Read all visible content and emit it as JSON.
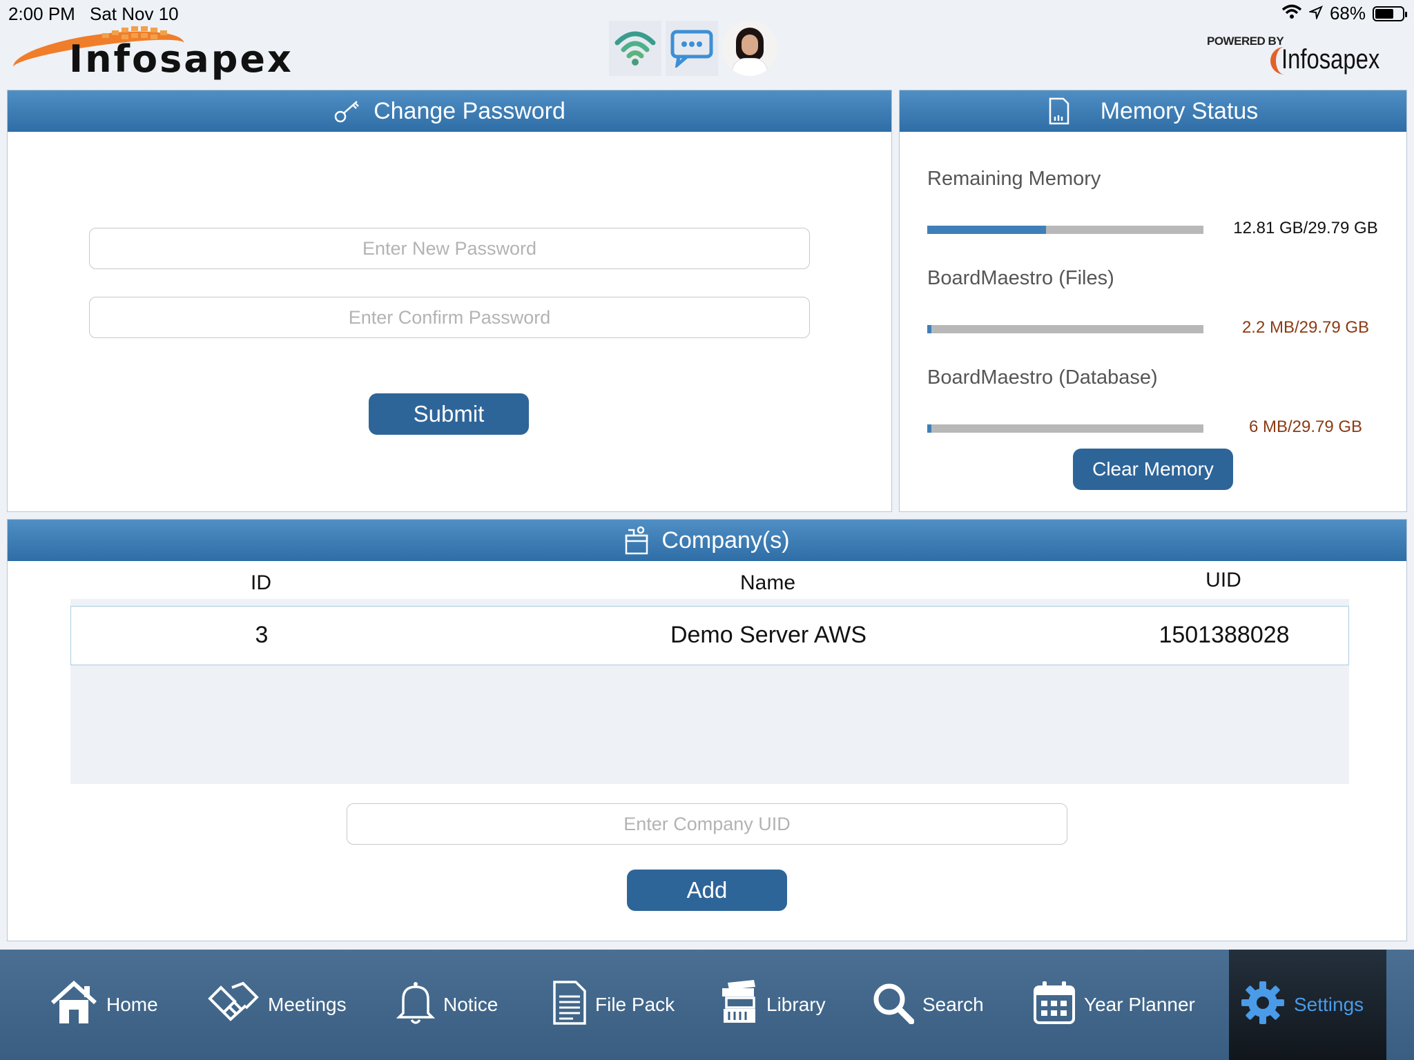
{
  "status_bar": {
    "time": "2:00 PM",
    "date": "Sat Nov 10",
    "battery": "68%",
    "battery_level": 0.68
  },
  "header": {
    "brand": "Infosapex",
    "powered_by": "POWERED BY",
    "powered_brand": "Infosapex"
  },
  "change_password": {
    "title": "Change Password",
    "new_password_placeholder": "Enter New Password",
    "confirm_password_placeholder": "Enter Confirm Password",
    "submit_label": "Submit"
  },
  "memory_status": {
    "title": "Memory Status",
    "items": [
      {
        "label": "Remaining Memory",
        "value": "12.81 GB/29.79 GB",
        "fraction": 0.43,
        "value_color": "#111111"
      },
      {
        "label": "BoardMaestro (Files)",
        "value": "2.2 MB/29.79 GB",
        "fraction": 0.015,
        "value_color": "#8b3a13"
      },
      {
        "label": "BoardMaestro (Database)",
        "value": "6 MB/29.79 GB",
        "fraction": 0.015,
        "value_color": "#8b3a13"
      }
    ],
    "clear_label": "Clear Memory"
  },
  "companies": {
    "title": "Company(s)",
    "columns": [
      "ID",
      "Name",
      "UID"
    ],
    "rows": [
      {
        "id": "3",
        "name": "Demo Server AWS",
        "uid": "1501388028"
      }
    ],
    "uid_placeholder": "Enter Company UID",
    "add_label": "Add"
  },
  "tabs": [
    {
      "label": "Home",
      "icon": "home-icon"
    },
    {
      "label": "Meetings",
      "icon": "handshake-icon"
    },
    {
      "label": "Notice",
      "icon": "bell-icon"
    },
    {
      "label": "File Pack",
      "icon": "document-icon"
    },
    {
      "label": "Library",
      "icon": "books-icon"
    },
    {
      "label": "Search",
      "icon": "search-icon"
    },
    {
      "label": "Year Planner",
      "icon": "calendar-icon"
    },
    {
      "label": "Settings",
      "icon": "gear-icon",
      "active": true
    }
  ],
  "colors": {
    "header_blue": "#2f6da6",
    "button_blue": "#2e6599",
    "active_tab_text": "#4a9be8",
    "wifi_teal": "#3a9c8c"
  }
}
